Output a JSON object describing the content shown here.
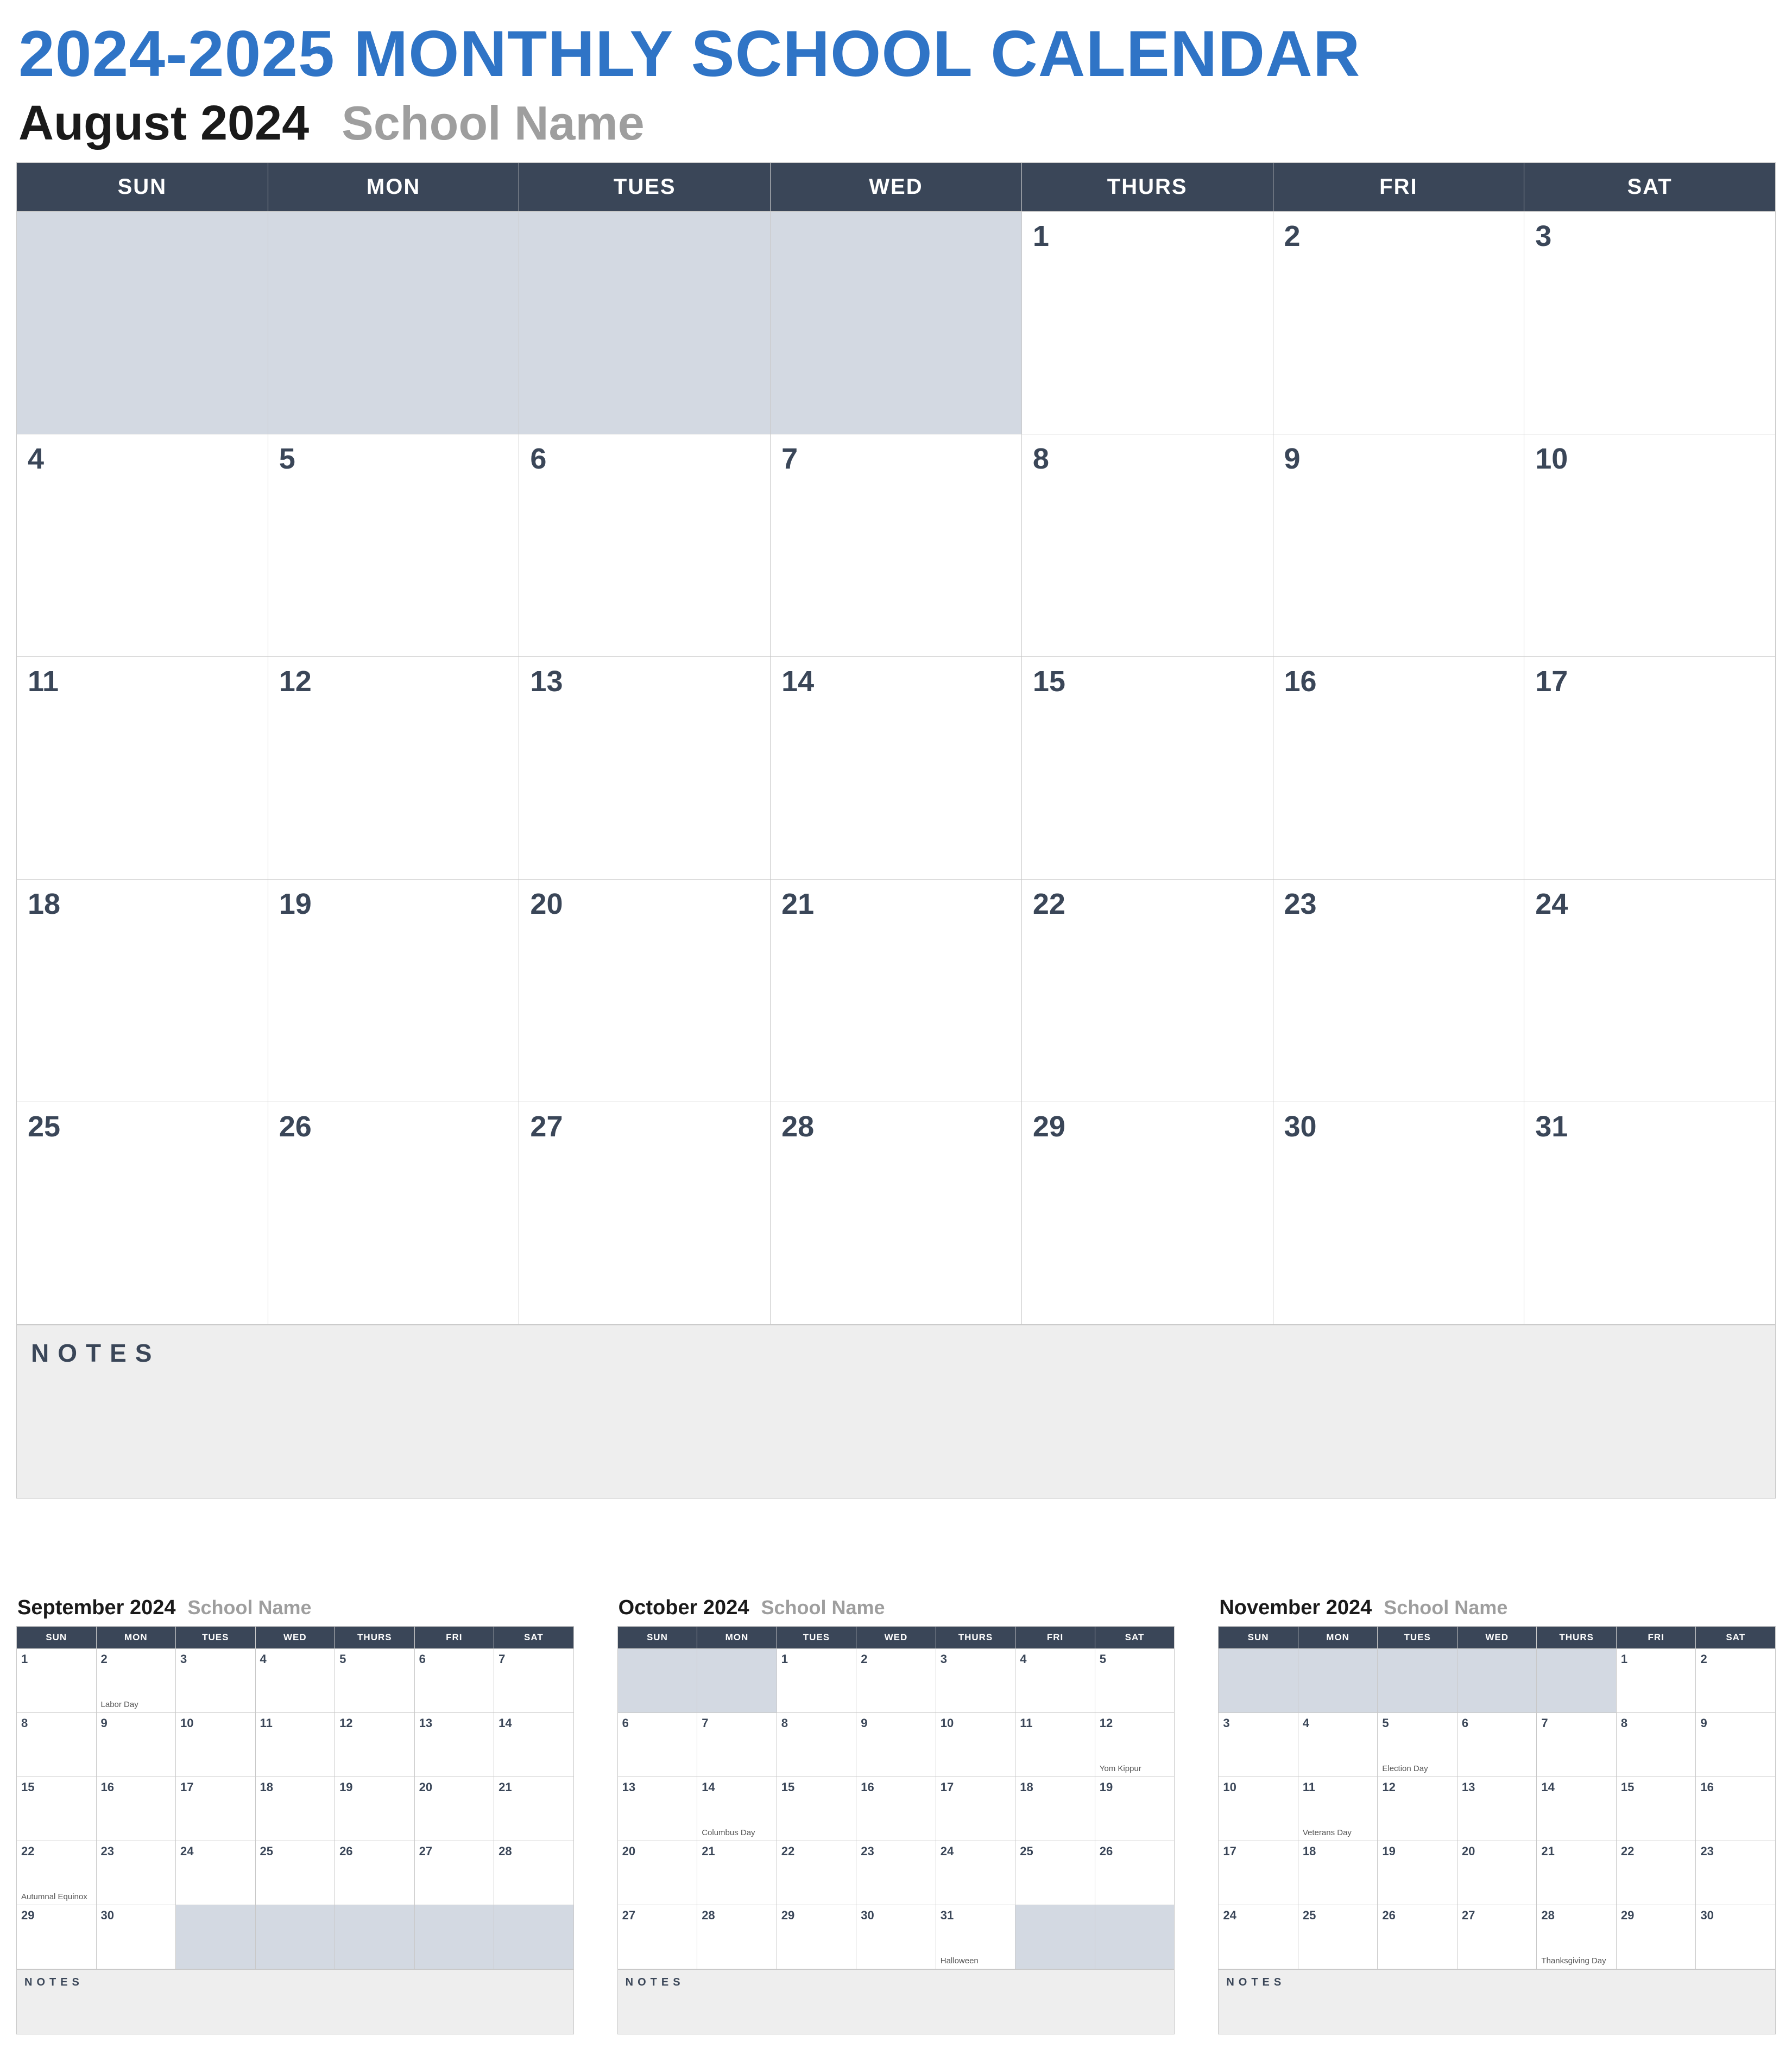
{
  "title": "2024-2025 MONTHLY SCHOOL CALENDAR",
  "school_name": "School Name",
  "notes_label": "NOTES",
  "day_headers": [
    "SUN",
    "MON",
    "TUES",
    "WED",
    "THURS",
    "FRI",
    "SAT"
  ],
  "main": {
    "month_label": "August 2024",
    "lead_pad": 4,
    "days": 31,
    "trail_pad": 0,
    "events": {}
  },
  "minis": [
    {
      "month_label": "September 2024",
      "lead_pad": 0,
      "days": 30,
      "trail_pad": 5,
      "events": {
        "2": "Labor Day",
        "22": "Autumnal Equinox"
      }
    },
    {
      "month_label": "October 2024",
      "lead_pad": 2,
      "days": 31,
      "trail_pad": 2,
      "events": {
        "12": "Yom Kippur",
        "14": "Columbus Day",
        "31": "Halloween"
      }
    },
    {
      "month_label": "November 2024",
      "lead_pad": 5,
      "days": 30,
      "trail_pad": 0,
      "events": {
        "5": "Election Day",
        "11": "Veterans Day",
        "28": "Thanksgiving Day"
      }
    }
  ]
}
